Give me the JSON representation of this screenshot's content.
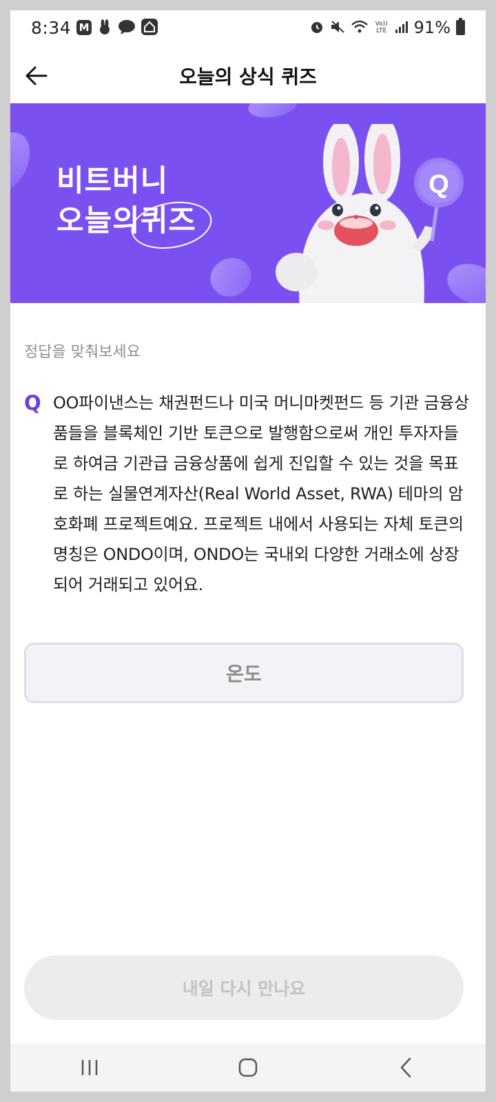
{
  "status_bar": {
    "time": "8:34",
    "app_icons": [
      "M",
      "🐰",
      "☁",
      "⌂"
    ],
    "battery": "91%",
    "volte": "Vo)) LTE"
  },
  "header": {
    "title": "오늘의 상식 퀴즈"
  },
  "banner": {
    "line1": "비트버니",
    "line2_prefix": "오늘의",
    "line2_highlight": "퀴즈",
    "badge": "Q",
    "background": "#7a50f0"
  },
  "quiz": {
    "prompt": "정답을 맞춰보세요",
    "q_mark": "Q",
    "question": "OO파이낸스는 채권펀드나 미국 머니마켓펀드 등 기관 금융상품들을 블록체인 기반 토큰으로 발행함으로써 개인 투자자들로 하여금 기관급 금융상품에 쉽게 진입할 수 있는 것을 목표로 하는 실물연계자산(Real World Asset, RWA) 테마의 암호화폐 프로젝트예요. 프로젝트 내에서 사용되는 자체 토큰의 명칭은 ONDO이며, ONDO는 국내외 다양한 거래소에 상장되어 거래되고 있어요.",
    "answer": "온도",
    "accent": "#6a3fe0"
  },
  "footer": {
    "button_label": "내일 다시 만나요"
  },
  "nav": {
    "icons": [
      "recent-apps-icon",
      "home-icon",
      "back-icon"
    ]
  }
}
